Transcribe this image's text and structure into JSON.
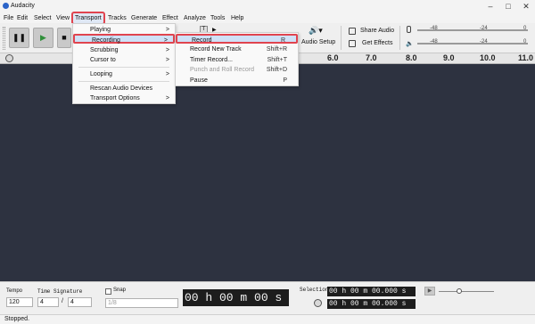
{
  "app": {
    "title": "Audacity"
  },
  "menubar": [
    "File",
    "Edit",
    "Select",
    "View",
    "Transport",
    "Tracks",
    "Generate",
    "Effect",
    "Analyze",
    "Tools",
    "Help"
  ],
  "transport_menu": {
    "playing": "Playing",
    "recording": "Recording",
    "scrubbing": "Scrubbing",
    "cursor_to": "Cursor to",
    "looping": "Looping",
    "rescan": "Rescan Audio Devices",
    "options": "Transport Options",
    "submenu_arrow": ">"
  },
  "recording_submenu": {
    "record": {
      "label": "Record",
      "shortcut": "R"
    },
    "record_new_track": {
      "label": "Record New Track",
      "shortcut": "Shift+R"
    },
    "timer_record": {
      "label": "Timer Record...",
      "shortcut": "Shift+T"
    },
    "punch_roll": {
      "label": "Punch and Roll Record",
      "shortcut": "Shift+D"
    },
    "pause": {
      "label": "Pause",
      "shortcut": "P"
    }
  },
  "toolbar": {
    "pause_icon": "❚❚",
    "play_icon": "▶",
    "stop_icon": "■",
    "audio_setup": "Audio Setup",
    "share_audio": "Share Audio",
    "get_effects": "Get Effects",
    "meter_ticks": [
      "-48",
      "-24",
      "0"
    ]
  },
  "ruler": {
    "ticks": [
      "6.0",
      "7.0",
      "8.0",
      "9.0",
      "10.0",
      "11.0"
    ]
  },
  "bottom": {
    "tempo_label": "Tempo",
    "tempo_value": "120",
    "time_signature_label": "Time Signature",
    "ts_numerator": "4",
    "ts_denominator": "4",
    "snap_label": "Snap",
    "snap_value": "1/8",
    "time_display": "00 h 00 m 00 s",
    "selection_label": "Selection",
    "selection_start": "00 h 00 m 00.000 s",
    "selection_end": "00 h 00 m 00.000 s"
  },
  "status": {
    "text": "Stopped."
  },
  "colors": {
    "track_bg": "#2d3240",
    "highlight_red": "#e0444f"
  }
}
